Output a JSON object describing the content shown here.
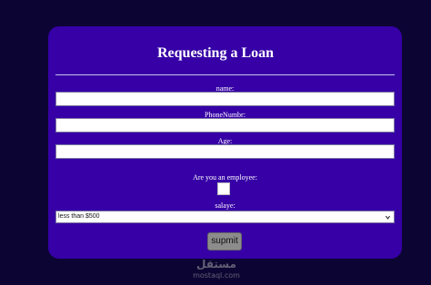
{
  "form": {
    "title": "Requesting a Loan",
    "name_label": "name:",
    "phone_label": "PhoneNumbr:",
    "age_label": "Age:",
    "employee_label": "Are you an employee:",
    "salary_label": "salaye:",
    "salary_selected": "less than $500",
    "submit_label": "supmit"
  },
  "watermark": {
    "arabic": "مستقل",
    "latin": "mostaql.com"
  },
  "colors": {
    "page_background": "#0c0533",
    "card_background": "#3600a6"
  },
  "icons": {
    "select_arrow": "chevron-down-icon"
  }
}
